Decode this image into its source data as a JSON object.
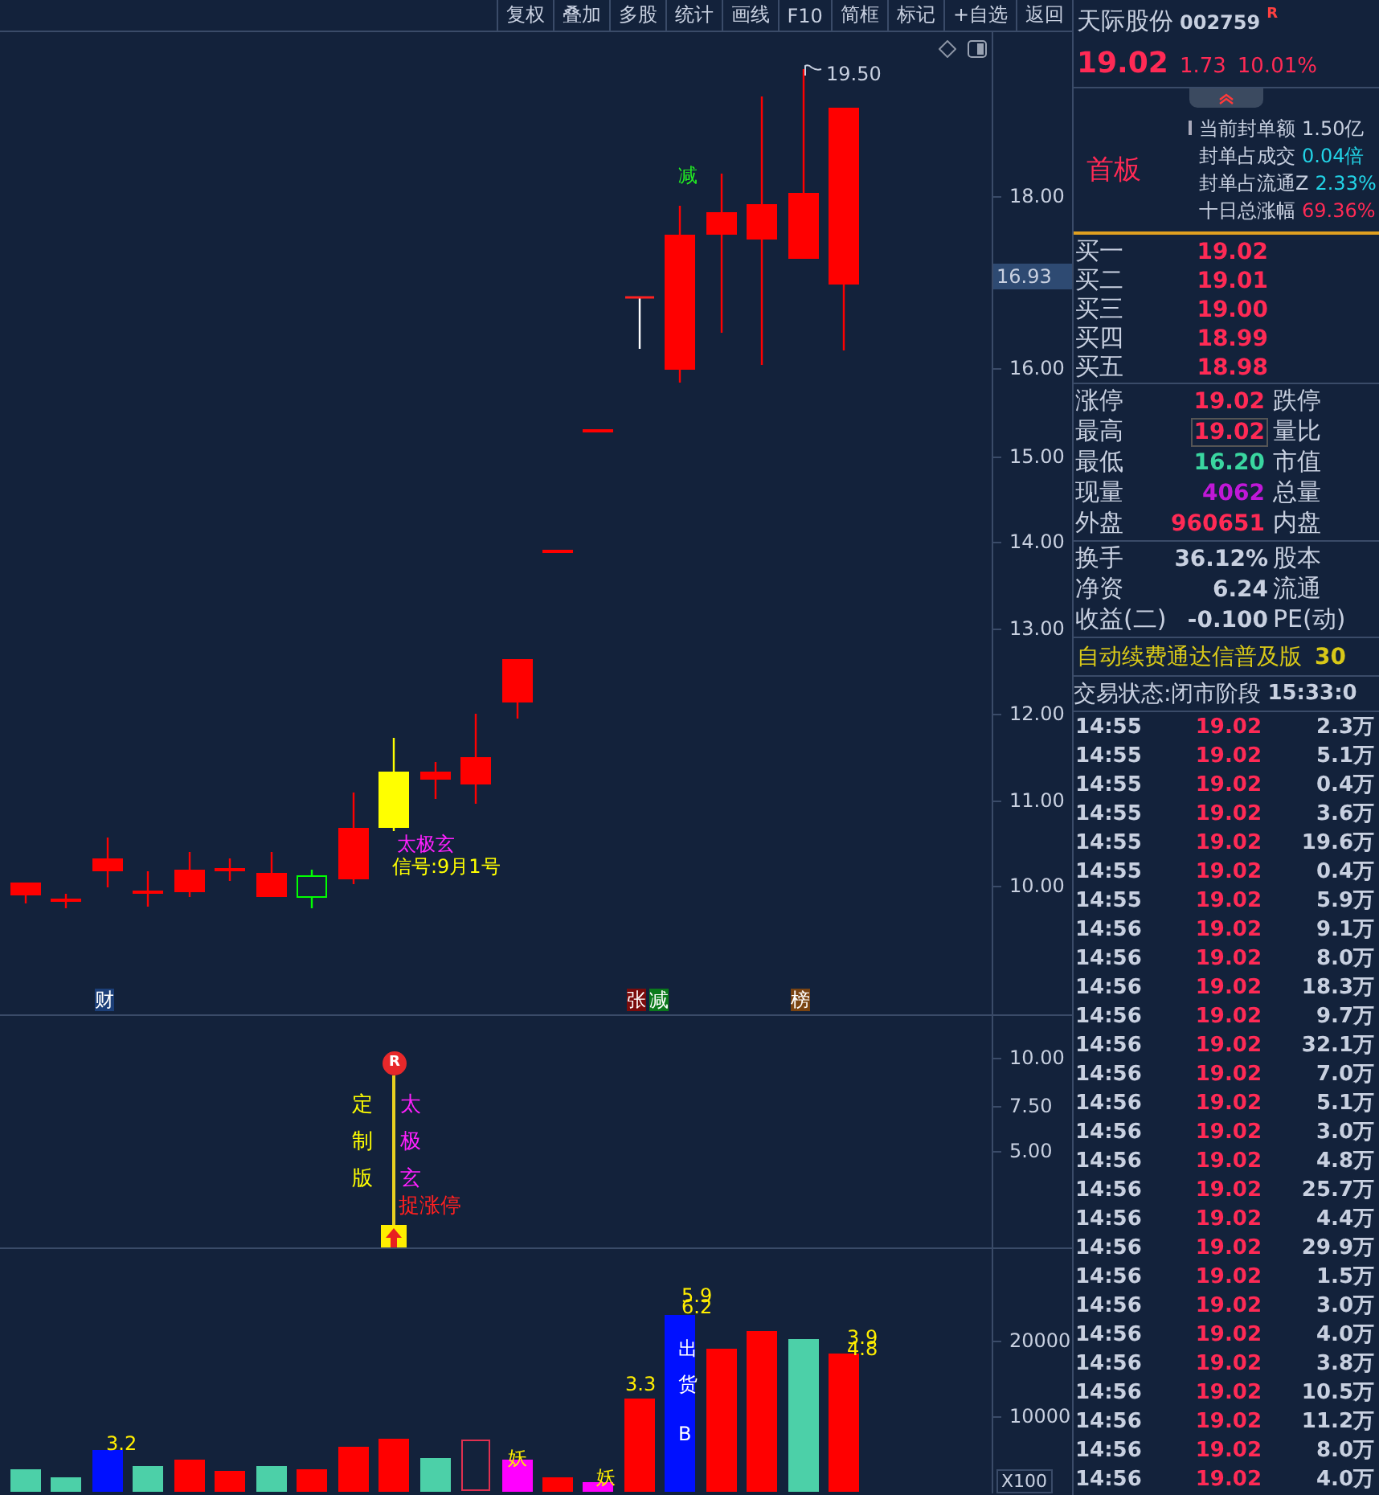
{
  "toolbar": {
    "buttons": [
      "复权",
      "叠加",
      "多股",
      "统计",
      "画线",
      "F10",
      "简框",
      "标记",
      "+自选",
      "返回"
    ]
  },
  "price_chart": {
    "y_axis": [
      "18.00",
      "16.00",
      "15.00",
      "14.00",
      "13.00",
      "12.00",
      "11.00",
      "10.00"
    ],
    "current_price": "16.93",
    "high_label": "19.50",
    "signal_mark": "减",
    "signal_name": "太极玄",
    "signal_date": "信号:9月1号",
    "markers": [
      {
        "text": "财",
        "color": "#1c3f78"
      },
      {
        "text": "张",
        "color": "#7a0c0c"
      },
      {
        "text": "减",
        "color": "#0b7a1c"
      },
      {
        "text": "榜",
        "color": "#7a4412"
      }
    ]
  },
  "indicator": {
    "y_axis": [
      "10.00",
      "7.50",
      "5.00"
    ],
    "pin_label": "R",
    "left_column": [
      "定",
      "制",
      "版"
    ],
    "right_column": [
      "太",
      "极",
      "玄"
    ],
    "alert": "捉涨停"
  },
  "volume": {
    "y_axis": [
      "20000",
      "10000"
    ],
    "scale": "X100",
    "bar_labels": [
      "3.2",
      "3.3",
      "5.9",
      "6.2",
      "3.9",
      "4.8"
    ],
    "bar_tags": [
      "妖",
      "妖"
    ],
    "sell_label": [
      "出",
      "货",
      "B"
    ]
  },
  "stock": {
    "name": "天际股份",
    "code": "002759",
    "badge": "R",
    "price": "19.02",
    "change": "1.73",
    "change_pct": "10.01%"
  },
  "board": {
    "label": "首板",
    "stats": [
      {
        "label": "当前封单额",
        "value": "1.50亿",
        "color": "#c8d0e0"
      },
      {
        "label": "封单占成交",
        "value": "0.04倍",
        "color": "#22d3e6"
      },
      {
        "label": "封单占流通Z",
        "value": "2.33%",
        "color": "#22d3e6"
      },
      {
        "label": "十日总涨幅",
        "value": "69.36%",
        "color": "#ff2a55"
      }
    ]
  },
  "bids": [
    {
      "label": "买一",
      "price": "19.02"
    },
    {
      "label": "买二",
      "price": "19.01"
    },
    {
      "label": "买三",
      "price": "19.00"
    },
    {
      "label": "买四",
      "price": "18.99"
    },
    {
      "label": "买五",
      "price": "18.98"
    }
  ],
  "quote": [
    {
      "label": "涨停",
      "value": "19.02",
      "color": "#ff2a55",
      "label2": "跌停",
      "highlighted": false
    },
    {
      "label": "最高",
      "value": "19.02",
      "color": "#ff2a55",
      "label2": "量比",
      "highlighted": true
    },
    {
      "label": "最低",
      "value": "16.20",
      "color": "#3ad6a0",
      "label2": "市值",
      "highlighted": false
    },
    {
      "label": "现量",
      "value": "4062",
      "color": "#c018d8",
      "label2": "总量",
      "highlighted": false
    },
    {
      "label": "外盘",
      "value": "960651",
      "color": "#ff2a55",
      "label2": "内盘",
      "highlighted": false
    }
  ],
  "fundamentals": [
    {
      "label": "换手",
      "value": "36.12%",
      "label2": "股本"
    },
    {
      "label": "净资",
      "value": "6.24",
      "label2": "流通"
    },
    {
      "label": "收益(二)",
      "value": "-0.100",
      "label2": "PE(动)"
    }
  ],
  "promo": {
    "text": "自动续费通达信普及版",
    "price": "30"
  },
  "status": {
    "label": "交易状态:闭市阶段",
    "time": "15:33:0"
  },
  "ticks": [
    {
      "time": "14:55",
      "price": "19.02",
      "volume": "2.3万"
    },
    {
      "time": "14:55",
      "price": "19.02",
      "volume": "5.1万"
    },
    {
      "time": "14:55",
      "price": "19.02",
      "volume": "0.4万"
    },
    {
      "time": "14:55",
      "price": "19.02",
      "volume": "3.6万"
    },
    {
      "time": "14:55",
      "price": "19.02",
      "volume": "19.6万"
    },
    {
      "time": "14:55",
      "price": "19.02",
      "volume": "0.4万"
    },
    {
      "time": "14:55",
      "price": "19.02",
      "volume": "5.9万"
    },
    {
      "time": "14:56",
      "price": "19.02",
      "volume": "9.1万"
    },
    {
      "time": "14:56",
      "price": "19.02",
      "volume": "8.0万"
    },
    {
      "time": "14:56",
      "price": "19.02",
      "volume": "18.3万"
    },
    {
      "time": "14:56",
      "price": "19.02",
      "volume": "9.7万"
    },
    {
      "time": "14:56",
      "price": "19.02",
      "volume": "32.1万"
    },
    {
      "time": "14:56",
      "price": "19.02",
      "volume": "7.0万"
    },
    {
      "time": "14:56",
      "price": "19.02",
      "volume": "5.1万"
    },
    {
      "time": "14:56",
      "price": "19.02",
      "volume": "3.0万"
    },
    {
      "time": "14:56",
      "price": "19.02",
      "volume": "4.8万"
    },
    {
      "time": "14:56",
      "price": "19.02",
      "volume": "25.7万"
    },
    {
      "time": "14:56",
      "price": "19.02",
      "volume": "4.4万"
    },
    {
      "time": "14:56",
      "price": "19.02",
      "volume": "29.9万"
    },
    {
      "time": "14:56",
      "price": "19.02",
      "volume": "1.5万"
    },
    {
      "time": "14:56",
      "price": "19.02",
      "volume": "3.0万"
    },
    {
      "time": "14:56",
      "price": "19.02",
      "volume": "4.0万"
    },
    {
      "time": "14:56",
      "price": "19.02",
      "volume": "3.8万"
    },
    {
      "time": "14:56",
      "price": "19.02",
      "volume": "10.5万"
    },
    {
      "time": "14:56",
      "price": "19.02",
      "volume": "11.2万"
    },
    {
      "time": "14:56",
      "price": "19.02",
      "volume": "8.0万"
    },
    {
      "time": "14:56",
      "price": "19.02",
      "volume": "4.0万"
    }
  ]
}
